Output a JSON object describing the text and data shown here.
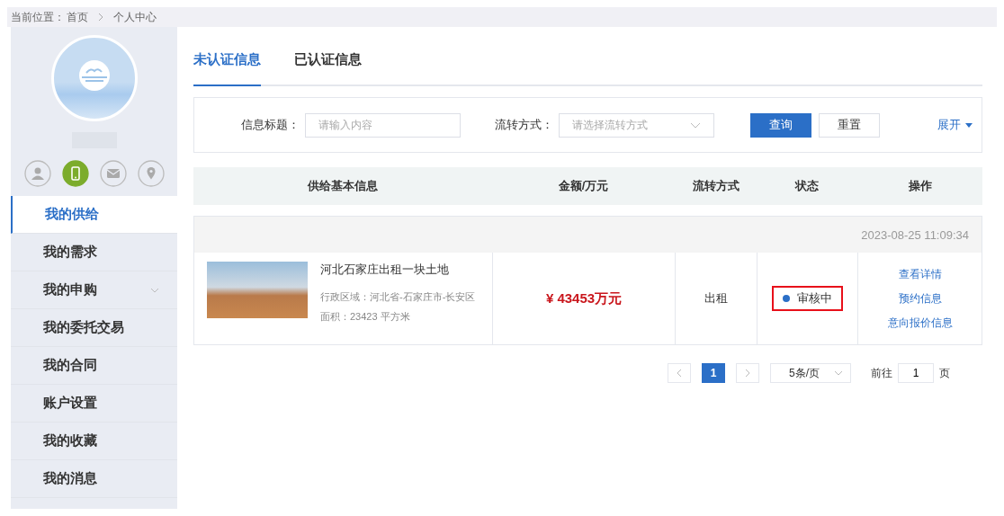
{
  "breadcrumb": {
    "label": "当前位置：",
    "items": [
      "首页",
      "个人中心"
    ]
  },
  "profile": {
    "badges": [
      {
        "kind": "person",
        "on": false
      },
      {
        "kind": "phone",
        "on": true
      },
      {
        "kind": "mail",
        "on": false
      },
      {
        "kind": "location",
        "on": false
      }
    ]
  },
  "sidebar": {
    "items": [
      {
        "label": "我的供给",
        "selected": true,
        "expandable": false
      },
      {
        "label": "我的需求",
        "selected": false,
        "expandable": false
      },
      {
        "label": "我的申购",
        "selected": false,
        "expandable": true
      },
      {
        "label": "我的委托交易",
        "selected": false,
        "expandable": false
      },
      {
        "label": "我的合同",
        "selected": false,
        "expandable": false
      },
      {
        "label": "账户设置",
        "selected": false,
        "expandable": false
      },
      {
        "label": "我的收藏",
        "selected": false,
        "expandable": false
      },
      {
        "label": "我的消息",
        "selected": false,
        "expandable": false
      }
    ]
  },
  "tabs": [
    {
      "label": "未认证信息",
      "selected": true
    },
    {
      "label": "已认证信息",
      "selected": false
    }
  ],
  "filter": {
    "title_label": "信息标题：",
    "title_placeholder": "请输入内容",
    "mode_label": "流转方式：",
    "mode_placeholder": "请选择流转方式",
    "search_button": "查询",
    "reset_button": "重置",
    "expand_link": "展开"
  },
  "table": {
    "columns": [
      "供给基本信息",
      "金额/万元",
      "流转方式",
      "状态",
      "操作"
    ],
    "rows": [
      {
        "time": "2023-08-25 11:09:34",
        "title": "河北石家庄出租一块土地",
        "region": "行政区域：河北省-石家庄市-长安区",
        "area": "面积：23423 平方米",
        "amount": "¥ 43453万元",
        "mode": "出租",
        "status": {
          "label": "审核中",
          "color": "#2b6fc7"
        },
        "highlighted": true,
        "actions": [
          "查看详情",
          "预约信息",
          "意向报价信息"
        ]
      }
    ]
  },
  "pagination": {
    "pages": [
      {
        "label": "1",
        "selected": true
      }
    ],
    "page_size": "5条/页",
    "goto_label": "前往",
    "goto_value": "1",
    "goto_suffix": "页"
  }
}
